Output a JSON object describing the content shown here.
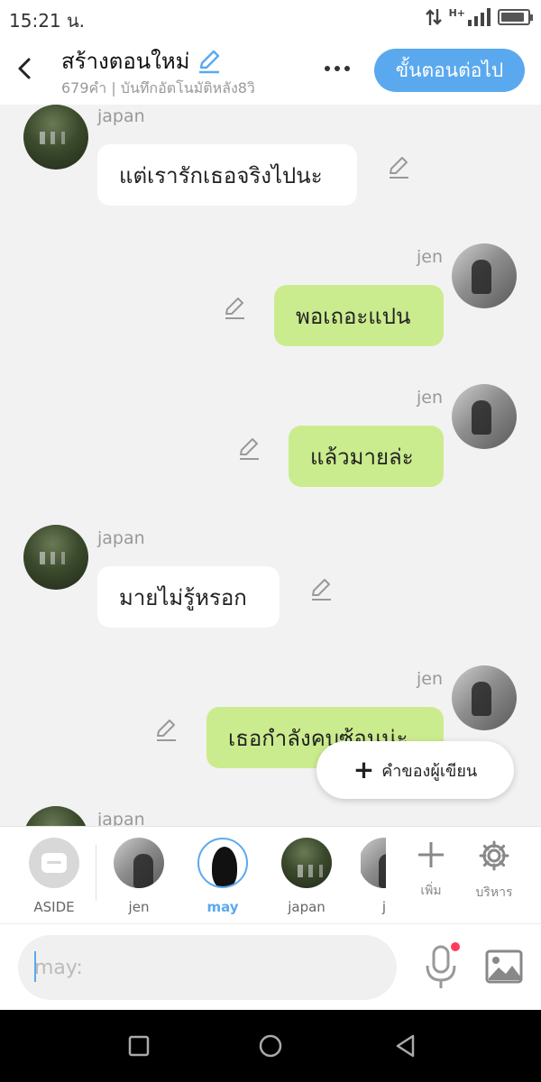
{
  "status_bar": {
    "time": "15:21 น.",
    "network": "H+",
    "battery_level": 0.9
  },
  "header": {
    "title": "สร้างตอนใหม่",
    "subtitle": "679คำ | บันทึกอัตโนมัติหลัง8วิ",
    "next_label": "ขั้นตอนต่อไป"
  },
  "messages": [
    {
      "side": "left",
      "sender": "japan",
      "text": "แต่เรารักเธอจริงไปนะ"
    },
    {
      "side": "right",
      "sender": "jen",
      "text": "พอเถอะแปน"
    },
    {
      "side": "right",
      "sender": "jen",
      "text": "แล้วมายล่ะ"
    },
    {
      "side": "left",
      "sender": "japan",
      "text": "มายไม่รู้หรอก"
    },
    {
      "side": "right",
      "sender": "jen",
      "text": "เธอกำลังคบซ้อนน่ะ"
    },
    {
      "side": "left",
      "sender": "japan",
      "text": ""
    }
  ],
  "author_note_label": "คำของผู้เขียน",
  "characters": [
    {
      "name": "ASIDE"
    },
    {
      "name": "jen"
    },
    {
      "name": "may",
      "active": true
    },
    {
      "name": "japan"
    },
    {
      "name": "j"
    }
  ],
  "tools": {
    "add_label": "เพิ่ม",
    "manage_label": "บริหาร"
  },
  "input": {
    "placeholder": "may:",
    "value": ""
  },
  "colors": {
    "accent": "#5aa9ee",
    "own_bubble": "#cbec8e",
    "other_bubble": "#ffffff",
    "record_dot": "#ff3b5c"
  }
}
